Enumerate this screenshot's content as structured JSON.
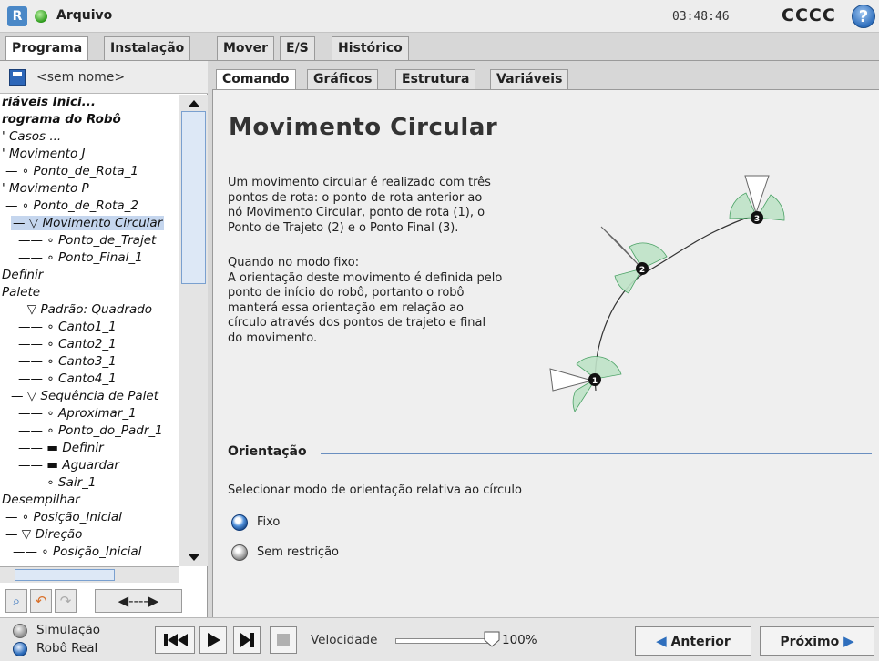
{
  "header": {
    "logo_text": "R",
    "menu_label": "Arquivo",
    "time": "03:48:46",
    "robot_name": "CCCC",
    "help_symbol": "?"
  },
  "main_tabs": [
    "Programa",
    "Instalação",
    "Mover",
    "E/S",
    "Histórico"
  ],
  "file": {
    "name": "<sem nome>"
  },
  "tree": [
    {
      "label": "riáveis Inici...",
      "bold": true
    },
    {
      "label": "rograma do Robô",
      "bold": true
    },
    {
      "label": "' Casos ..."
    },
    {
      "label": "' Movimento J"
    },
    {
      "label": "— ∘ Ponto_de_Rota_1"
    },
    {
      "label": "' Movimento P"
    },
    {
      "label": "— ∘ Ponto_de_Rota_2"
    },
    {
      "label": "— ▽ Movimento Circular",
      "selected": true
    },
    {
      "label": "—— ∘ Ponto_de_Trajet"
    },
    {
      "label": "—— ∘ Ponto_Final_1"
    },
    {
      "label": "Definir"
    },
    {
      "label": "Palete"
    },
    {
      "label": "— ▽ Padrão: Quadrado"
    },
    {
      "label": "—— ∘ Canto1_1"
    },
    {
      "label": "—— ∘ Canto2_1"
    },
    {
      "label": "—— ∘ Canto3_1"
    },
    {
      "label": "—— ∘ Canto4_1"
    },
    {
      "label": "— ▽ Sequência de Palet"
    },
    {
      "label": "—— ∘ Aproximar_1"
    },
    {
      "label": "—— ∘ Ponto_do_Padr_1"
    },
    {
      "label": "—— ▬ Definir"
    },
    {
      "label": "—— ▬ Aguardar"
    },
    {
      "label": "—— ∘ Sair_1"
    },
    {
      "label": "Desempilhar"
    },
    {
      "label": "— ∘ Posição_Inicial"
    },
    {
      "label": "— ▽ Direção"
    },
    {
      "label": "—— ∘ Posição_Inicial"
    }
  ],
  "sub_tabs": [
    "Comando",
    "Gráficos",
    "Estrutura",
    "Variáveis"
  ],
  "command": {
    "title": "Movimento Circular",
    "para1": [
      "Um movimento circular é realizado com três",
      "pontos de rota: o ponto de rota anterior ao",
      "nó Movimento Circular, ponto de rota (1), o",
      "Ponto de Trajeto (2) e o Ponto Final (3)."
    ],
    "para2": [
      "Quando no modo fixo:",
      "A orientação deste movimento é definida pelo",
      "ponto de início do robô, portanto o robô",
      "manterá essa orientação em relação ao",
      "círculo através dos pontos de trajeto e final",
      "do movimento."
    ],
    "diagram_points": [
      "1",
      "2",
      "3"
    ],
    "orientation_heading": "Orientação",
    "orientation_help": "Selecionar modo de orientação relativa ao círculo",
    "option_fixed": "Fixo",
    "option_free": "Sem restrição",
    "selected_option": "Fixo"
  },
  "bottom": {
    "mode_sim": "Simulação",
    "mode_real": "Robô Real",
    "speed_label": "Velocidade",
    "speed_value": "100%",
    "speed_fraction": 1.0,
    "prev_label": "Anterior",
    "next_label": "Próximo"
  }
}
